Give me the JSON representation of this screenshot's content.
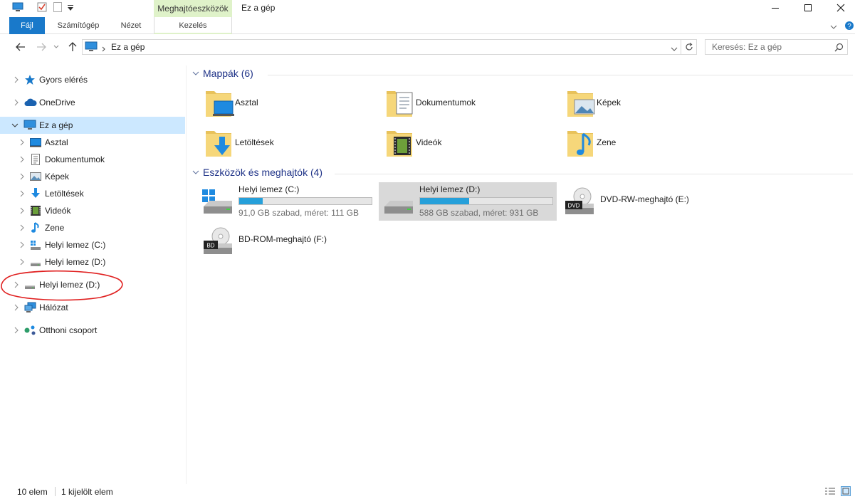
{
  "window": {
    "title": "Ez a gép",
    "context_tab_header": "Meghajtóeszközök",
    "colors": {
      "accent": "#1979ca",
      "context_tab": "#dff2c9",
      "selection": "#cce8ff",
      "progress": "#26a0da",
      "group_title": "#1e3287"
    }
  },
  "ribbon": {
    "tabs": [
      "Fájl",
      "Számítógép",
      "Nézet",
      "Kezelés"
    ]
  },
  "address": {
    "path": "Ez a gép",
    "search_placeholder": "Keresés: Ez a gép"
  },
  "nav": {
    "items": [
      {
        "label": "Gyors elérés",
        "icon": "star-icon"
      },
      {
        "label": "OneDrive",
        "icon": "cloud-icon"
      },
      {
        "label": "Ez a gép",
        "icon": "computer-icon"
      },
      {
        "label": "Asztal",
        "icon": "desktop-icon"
      },
      {
        "label": "Dokumentumok",
        "icon": "document-icon"
      },
      {
        "label": "Képek",
        "icon": "pictures-icon"
      },
      {
        "label": "Letöltések",
        "icon": "download-icon"
      },
      {
        "label": "Videók",
        "icon": "video-icon"
      },
      {
        "label": "Zene",
        "icon": "music-icon"
      },
      {
        "label": "Helyi lemez (C:)",
        "icon": "windows-drive-icon"
      },
      {
        "label": "Helyi lemez (D:)",
        "icon": "drive-icon"
      },
      {
        "label": "Helyi lemez (D:)",
        "icon": "drive-icon"
      },
      {
        "label": "Hálózat",
        "icon": "network-icon"
      },
      {
        "label": "Otthoni csoport",
        "icon": "homegroup-icon"
      }
    ]
  },
  "content": {
    "folders_header": "Mappák (6)",
    "folders": [
      {
        "label": "Asztal",
        "icon": "desktop-folder-icon"
      },
      {
        "label": "Dokumentumok",
        "icon": "documents-folder-icon"
      },
      {
        "label": "Képek",
        "icon": "pictures-folder-icon"
      },
      {
        "label": "Letöltések",
        "icon": "downloads-folder-icon"
      },
      {
        "label": "Videók",
        "icon": "videos-folder-icon"
      },
      {
        "label": "Zene",
        "icon": "music-folder-icon"
      }
    ],
    "devices_header": "Eszközök és meghajtók (4)",
    "drives": [
      {
        "name": "Helyi lemez (C:)",
        "info": "91,0 GB szabad, méret: 111 GB",
        "used_fraction": 0.18
      },
      {
        "name": "Helyi lemez (D:)",
        "info": "588 GB szabad, méret: 931 GB",
        "used_fraction": 0.37
      },
      {
        "name": "DVD-RW-meghajtó (E:)",
        "badge": "DVD"
      },
      {
        "name": "BD-ROM-meghajtó (F:)",
        "badge": "BD"
      }
    ]
  },
  "status": {
    "item_count": "10 elem",
    "selected_count": "1 kijelölt elem"
  }
}
